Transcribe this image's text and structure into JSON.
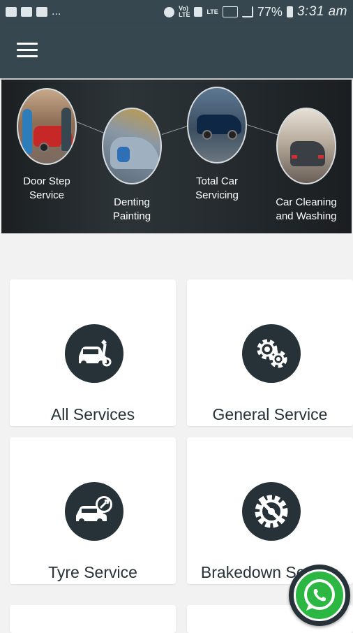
{
  "status_bar": {
    "left_icons": [
      "image-icon",
      "message-icon",
      "hi-icon"
    ],
    "overflow": "...",
    "network_label_top": "Vo)",
    "network_label_bottom": "LTE",
    "lte_label": "LTE",
    "battery_percent": "77%",
    "time": "3:31 am"
  },
  "app_bar": {
    "menu_icon": "hamburger-menu-icon",
    "color": "#37474f"
  },
  "banner": {
    "items": [
      {
        "label_line1": "Door Step",
        "label_line2": "Service"
      },
      {
        "label_line1": "Denting",
        "label_line2": "Painting"
      },
      {
        "label_line1": "Total Car",
        "label_line2": "Servicing"
      },
      {
        "label_line1": "Car Cleaning",
        "label_line2": "and Washing"
      }
    ]
  },
  "services": [
    {
      "label": "All Services",
      "icon": "car-wrench-icon"
    },
    {
      "label": "General Service",
      "icon": "gears-icon"
    },
    {
      "label": "Tyre Service",
      "icon": "car-tyre-icon"
    },
    {
      "label": "Brakedown Service",
      "icon": "broken-gear-icon"
    }
  ],
  "fab": {
    "icon": "whatsapp-icon",
    "color": "#2bb741"
  },
  "colors": {
    "primary_dark": "#263238",
    "app_bar": "#37474f",
    "background": "#f2f2f2"
  }
}
